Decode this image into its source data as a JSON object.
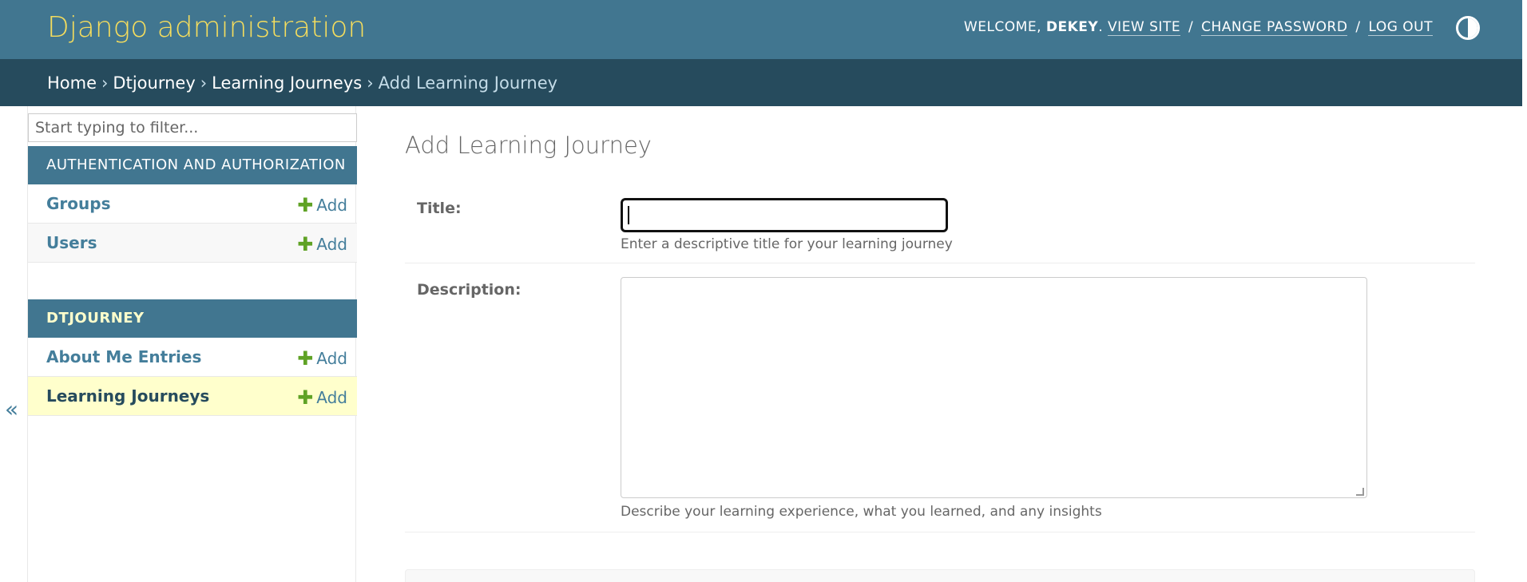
{
  "header": {
    "site_name": "Django administration",
    "welcome_prefix": "WELCOME, ",
    "username": "DEKEY",
    "welcome_suffix": ".",
    "view_site": "VIEW SITE",
    "change_password": "CHANGE PASSWORD",
    "log_out": "LOG OUT",
    "separator": "/",
    "theme_toggle_icon": "half-circle-contrast-icon"
  },
  "breadcrumbs": {
    "items": [
      "Home",
      "Dtjourney",
      "Learning Journeys"
    ],
    "current": "Add Learning Journey",
    "separator": "›"
  },
  "sidebar": {
    "filter_placeholder": "Start typing to filter...",
    "modules": [
      {
        "name": "AUTHENTICATION AND AUTHORIZATION",
        "models": [
          {
            "label": "Groups",
            "add_label": "Add"
          },
          {
            "label": "Users",
            "add_label": "Add"
          }
        ]
      },
      {
        "name": "DTJOURNEY",
        "models": [
          {
            "label": "About Me Entries",
            "add_label": "Add"
          },
          {
            "label": "Learning Journeys",
            "add_label": "Add",
            "current": true
          }
        ]
      }
    ],
    "collapse_icon": "«"
  },
  "form": {
    "title": "Add Learning Journey",
    "fields": [
      {
        "label": "Title:",
        "value": "",
        "help": "Enter a descriptive title for your learning journey"
      },
      {
        "label": "Description:",
        "value": "",
        "help": "Describe your learning experience, what you learned, and any insights"
      }
    ]
  },
  "colors": {
    "header_bg": "#417690",
    "breadcrumbs_bg": "#264b5d",
    "branding": "#f5dd5d",
    "link": "#447e9b",
    "add_plus": "#5fa225",
    "current_row": "#ffffcc"
  }
}
